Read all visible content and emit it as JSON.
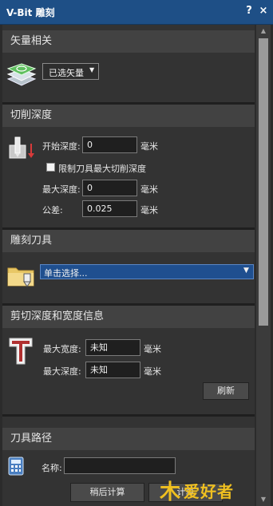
{
  "window": {
    "title": "V-Bit 雕刻",
    "help_label": "?",
    "close_label": "×"
  },
  "sections": {
    "vector": {
      "header": "矢量相关",
      "selection_dropdown": "已选矢量",
      "icon": "vector-layers-icon"
    },
    "cut_depth": {
      "header": "切削深度",
      "icon": "cut-depth-icon",
      "start_depth_label": "开始深度:",
      "start_depth_value": "0",
      "start_depth_unit": "毫米",
      "limit_checkbox_label": "限制刀具最大切削深度",
      "limit_checked": false,
      "max_depth_label": "最大深度:",
      "max_depth_value": "0",
      "max_depth_unit": "毫米",
      "tolerance_label": "公差:",
      "tolerance_value": "0.025",
      "tolerance_unit": "毫米"
    },
    "tool": {
      "header": "雕刻刀具",
      "icon": "tool-folder-icon",
      "select_value": "单击选择..."
    },
    "cut_info": {
      "header": "剪切深度和宽度信息",
      "icon": "t-profile-icon",
      "max_width_label": "最大宽度:",
      "max_width_value": "未知",
      "max_width_unit": "毫米",
      "max_depth_label": "最大深度:",
      "max_depth_value": "未知",
      "max_depth_unit": "毫米",
      "refresh_button": "刷新"
    },
    "toolpath": {
      "header": "刀具路径",
      "icon": "calculator-icon",
      "name_label": "名称:",
      "name_value": "",
      "calc_later_button": "稍后计算",
      "calc_button": "计算"
    }
  },
  "watermark": "爱好者",
  "colors": {
    "titlebar": "#1e4f86",
    "panel": "#333333",
    "header": "#424242",
    "select_blue": "#1f4f8f"
  }
}
